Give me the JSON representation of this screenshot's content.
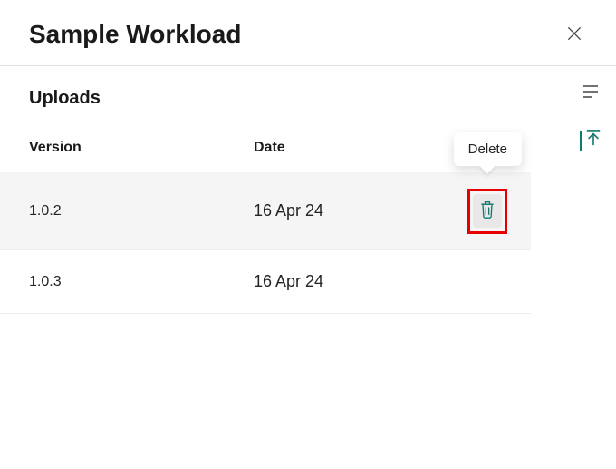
{
  "header": {
    "title": "Sample Workload"
  },
  "section": {
    "title": "Uploads"
  },
  "table": {
    "headers": {
      "version": "Version",
      "date": "Date"
    },
    "rows": [
      {
        "version": "1.0.2",
        "date": "16 Apr 24",
        "highlighted": true,
        "showDelete": true
      },
      {
        "version": "1.0.3",
        "date": "16 Apr 24",
        "highlighted": false,
        "showDelete": false
      }
    ]
  },
  "tooltip": {
    "delete": "Delete"
  },
  "colors": {
    "accent": "#0f7b6c",
    "highlight_border": "#e60000"
  }
}
